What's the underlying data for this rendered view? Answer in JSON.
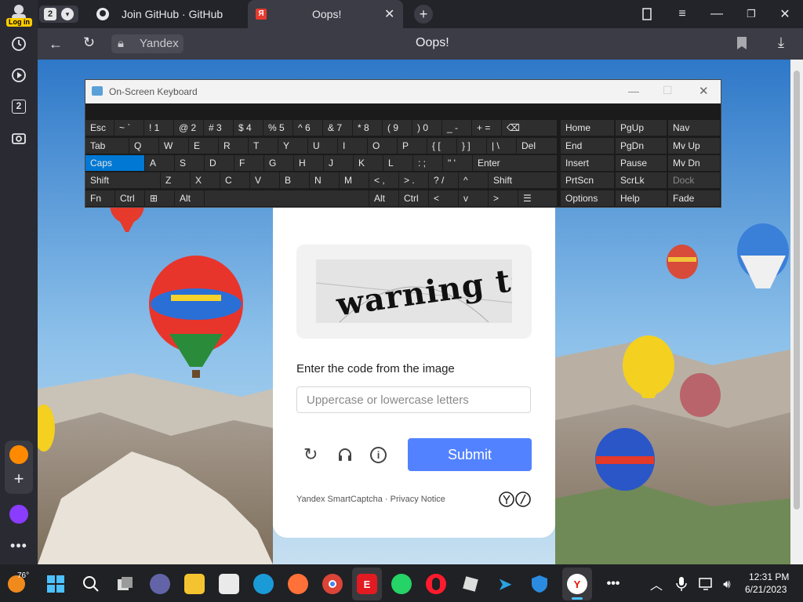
{
  "browser": {
    "profile_login": "Log in",
    "tab_count": "2",
    "tabs": [
      {
        "title": "Join GitHub · GitHub"
      },
      {
        "title": "Oops!"
      }
    ],
    "address_label": "Yandex",
    "page_title": "Oops!",
    "sidebar_badge": "2"
  },
  "osk": {
    "title": "On-Screen Keyboard",
    "row1": [
      "Esc",
      "~ `",
      "! 1",
      "@ 2",
      "# 3",
      "$ 4",
      "% 5",
      "^ 6",
      "& 7",
      "* 8",
      "( 9",
      ") 0",
      "_ -",
      "+ =",
      "⌫"
    ],
    "row2": [
      "Tab",
      "Q",
      "W",
      "E",
      "R",
      "T",
      "Y",
      "U",
      "I",
      "O",
      "P",
      "{ [",
      "} ]",
      "| \\",
      "Del"
    ],
    "row3": [
      "Caps",
      "A",
      "S",
      "D",
      "F",
      "G",
      "H",
      "J",
      "K",
      "L",
      ": ;",
      "\" '",
      "Enter"
    ],
    "row4": [
      "Shift",
      "Z",
      "X",
      "C",
      "V",
      "B",
      "N",
      "M",
      "< ,",
      "> .",
      "? /",
      "^",
      "Shift"
    ],
    "row5": [
      "Fn",
      "Ctrl",
      "⊞",
      "Alt",
      "",
      "Alt",
      "Ctrl",
      "<",
      "v",
      ">",
      "☰"
    ],
    "side": [
      [
        "Home",
        "PgUp",
        "Nav"
      ],
      [
        "End",
        "PgDn",
        "Mv Up"
      ],
      [
        "Insert",
        "Pause",
        "Mv Dn"
      ],
      [
        "PrtScn",
        "ScrLk",
        "Dock"
      ],
      [
        "Options",
        "Help",
        "Fade"
      ]
    ]
  },
  "captcha": {
    "image_text": "warning tsar",
    "prompt": "Enter the code from the image",
    "input_placeholder": "Uppercase or lowercase letters",
    "submit_label": "Submit",
    "footer_text": "Yandex SmartCaptcha · Privacy Notice"
  },
  "taskbar": {
    "weather": "76°",
    "time": "12:31 PM",
    "date": "6/21/2023"
  },
  "colors": {
    "submit": "#5282ff",
    "caps_highlight": "#0078d4",
    "dark_chrome": "#2a2b32"
  }
}
